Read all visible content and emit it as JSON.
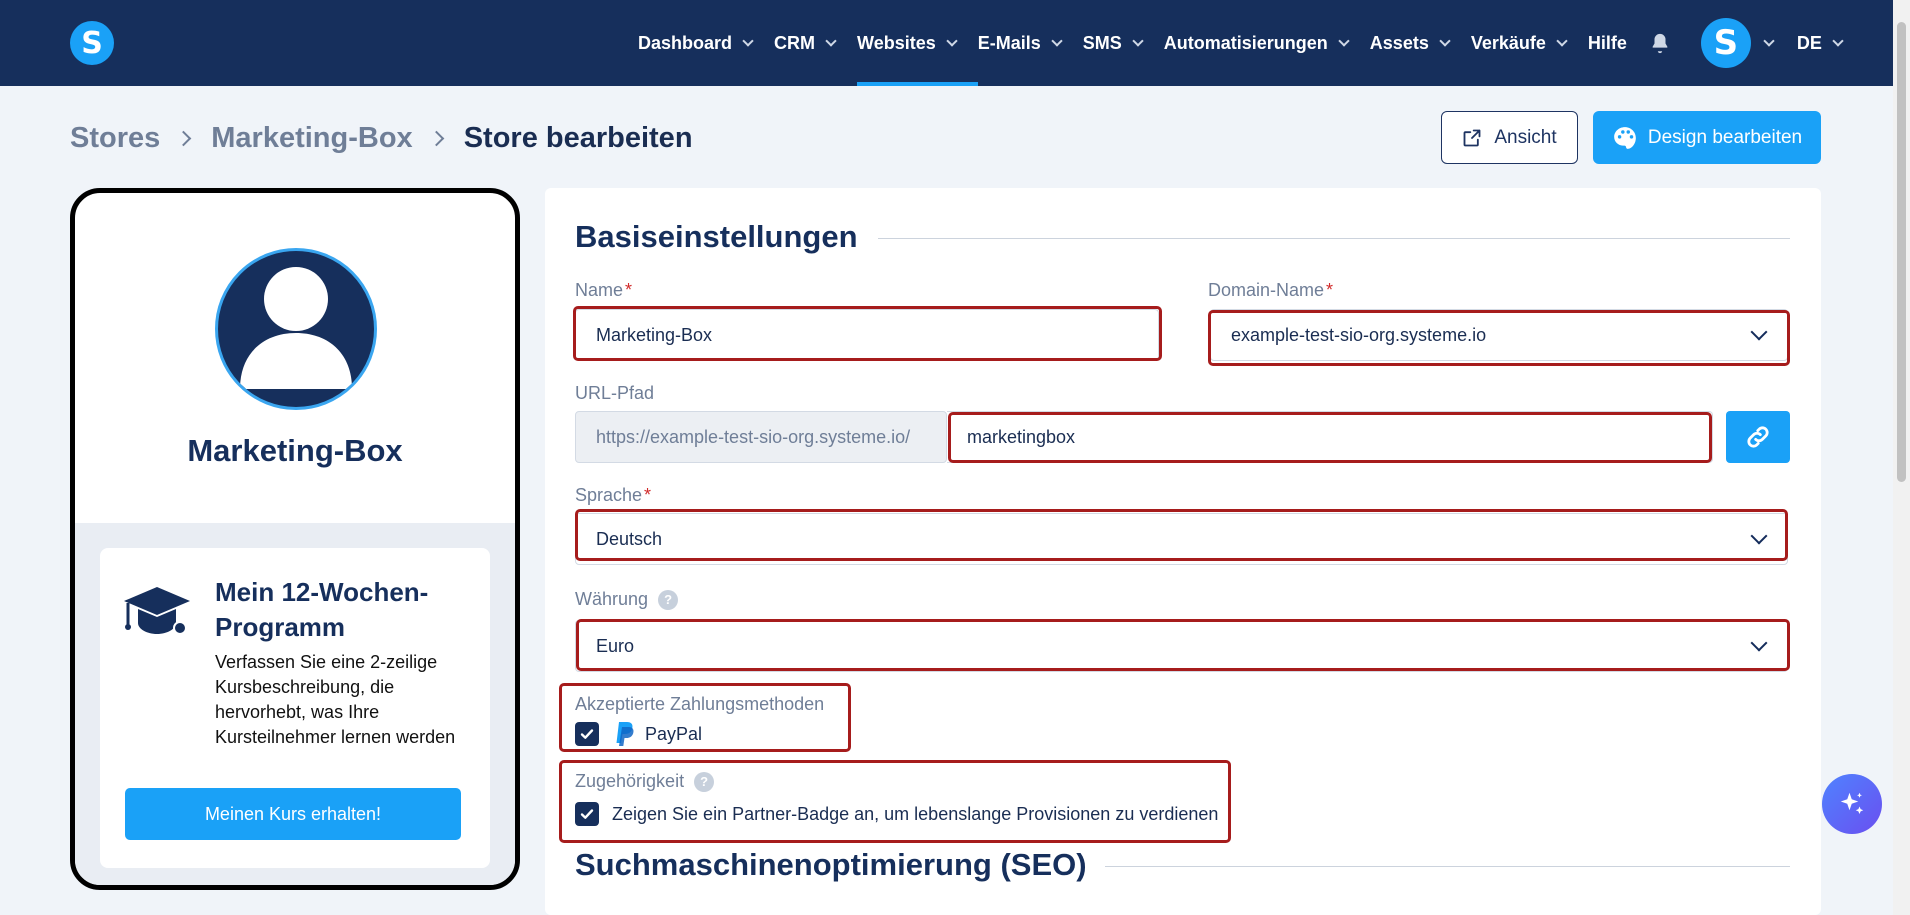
{
  "nav": {
    "items": [
      {
        "label": "Dashboard",
        "has_menu": true
      },
      {
        "label": "CRM",
        "has_menu": true
      },
      {
        "label": "Websites",
        "has_menu": true,
        "active": true
      },
      {
        "label": "E-Mails",
        "has_menu": true
      },
      {
        "label": "SMS",
        "has_menu": true
      },
      {
        "label": "Automatisierungen",
        "has_menu": true
      },
      {
        "label": "Assets",
        "has_menu": true
      },
      {
        "label": "Verkäufe",
        "has_menu": true
      },
      {
        "label": "Hilfe",
        "has_menu": false
      }
    ],
    "logo_letter": "S",
    "avatar_letter": "S",
    "language": "DE"
  },
  "breadcrumb": {
    "items": [
      "Stores",
      "Marketing-Box",
      "Store bearbeiten"
    ]
  },
  "actions": {
    "view_label": "Ansicht",
    "design_label": "Design bearbeiten"
  },
  "preview": {
    "store_name": "Marketing-Box",
    "course_title": "Mein 12-Wochen-Programm",
    "course_description": "Verfassen Sie eine 2-zeilige Kursbeschreibung, die hervorhebt, was Ihre Kursteilnehmer lernen werden",
    "course_button": "Meinen Kurs erhalten!"
  },
  "basic": {
    "title": "Basiseinstellungen",
    "name_label": "Name",
    "name_value": "Marketing-Box",
    "domain_label": "Domain-Name",
    "domain_value": "example-test-sio-org.systeme.io",
    "url_label": "URL-Pfad",
    "url_prefix": "https://example-test-sio-org.systeme.io/",
    "url_path": "marketingbox",
    "language_label": "Sprache",
    "language_value": "Deutsch",
    "currency_label": "Währung",
    "currency_value": "Euro",
    "payment_label": "Akzeptierte Zahlungsmethoden",
    "payment_option": "PayPal",
    "payment_checked": true,
    "affiliation_label": "Zugehörigkeit",
    "affiliation_option": "Zeigen Sie ein Partner-Badge an, um lebenslange Provisionen zu verdienen",
    "affiliation_checked": true,
    "required_mark": "*",
    "help_mark": "?"
  },
  "seo": {
    "title": "Suchmaschinenoptimierung (SEO)"
  },
  "colors": {
    "nav_bg": "#162f5c",
    "accent": "#1aa1f7",
    "highlight": "#a61c1c",
    "page_bg": "#f0f4f9"
  },
  "icons": [
    "bell-icon",
    "external-link-icon",
    "palette-icon",
    "link-icon",
    "graduation-cap-icon",
    "paypal-icon",
    "check-icon",
    "sparkle-icon",
    "chevron-down-icon"
  ]
}
